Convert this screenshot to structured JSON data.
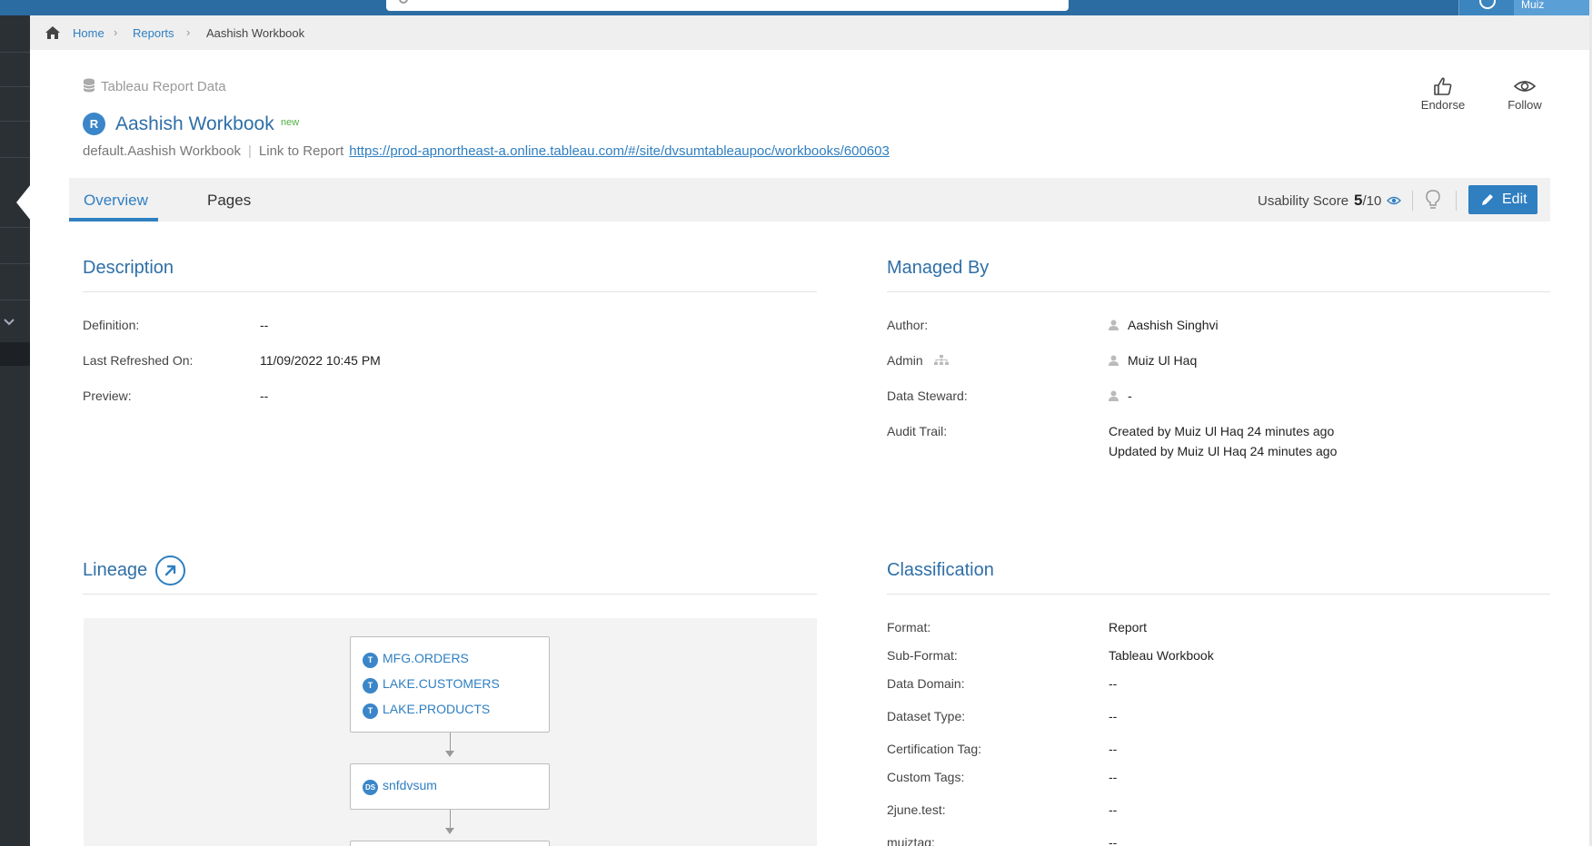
{
  "topbar": {
    "user_name": "Muiz"
  },
  "breadcrumb": {
    "home": "Home",
    "reports": "Reports",
    "current": "Aashish Workbook"
  },
  "header": {
    "asset_type": "Tableau Report Data",
    "badge_letter": "R",
    "title": "Aashish Workbook",
    "new_badge": "new",
    "qualified_name": "default.Aashish Workbook",
    "link_label": "Link to Report",
    "link_url": "https://prod-apnortheast-a.online.tableau.com/#/site/dvsumtableaupoc/workbooks/600603",
    "endorse": "Endorse",
    "follow": "Follow"
  },
  "tabs": {
    "overview": "Overview",
    "pages": "Pages"
  },
  "usability": {
    "label": "Usability Score",
    "score": "5",
    "out_of": "/10"
  },
  "edit_label": "Edit",
  "description": {
    "title": "Description",
    "fields": [
      {
        "label": "Definition:",
        "value": "--"
      },
      {
        "label": "Last Refreshed On:",
        "value": "11/09/2022 10:45 PM"
      },
      {
        "label": "Preview:",
        "value": "--"
      }
    ]
  },
  "managed_by": {
    "title": "Managed By",
    "author_label": "Author:",
    "author": "Aashish Singhvi",
    "admin_label": "Admin",
    "admin": "Muiz Ul Haq",
    "steward_label": "Data Steward:",
    "steward": "-",
    "audit_label": "Audit Trail:",
    "audit_created": "Created by Muiz Ul Haq 24 minutes ago",
    "audit_updated": "Updated by Muiz Ul Haq 24 minutes ago"
  },
  "lineage": {
    "title": "Lineage",
    "tables": [
      {
        "badge": "T",
        "name": "MFG.ORDERS"
      },
      {
        "badge": "T",
        "name": "LAKE.CUSTOMERS"
      },
      {
        "badge": "T",
        "name": "LAKE.PRODUCTS"
      }
    ],
    "datasource": {
      "badge": "DS",
      "name": "snfdvsum"
    }
  },
  "classification": {
    "title": "Classification",
    "fields": [
      {
        "label": "Format:",
        "value": "Report"
      },
      {
        "label": "Sub-Format:",
        "value": "Tableau Workbook"
      },
      {
        "label": "Data Domain:",
        "value": "--"
      },
      {
        "label": "Dataset Type:",
        "value": "--"
      },
      {
        "label": "Certification Tag:",
        "value": "--"
      },
      {
        "label": "Custom Tags:",
        "value": "--"
      },
      {
        "label": "2june.test:",
        "value": "--"
      },
      {
        "label": "muiztag:",
        "value": "--"
      }
    ]
  },
  "colors": {
    "topbar": "#2b6ca3",
    "accent": "#2f7fc1",
    "rail": "#2b3035",
    "new": "#52b041"
  }
}
